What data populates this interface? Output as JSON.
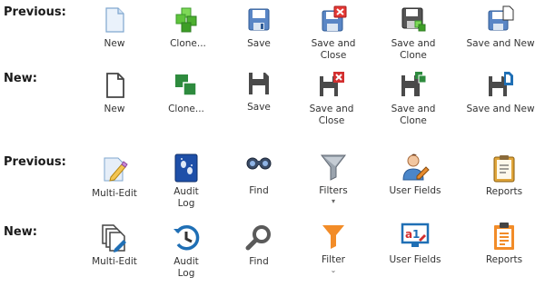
{
  "sections": {
    "s1_previous": "Previous:",
    "s1_new": "New:",
    "s2_previous": "Previous:",
    "s2_new": "New:"
  },
  "row1_previous": [
    {
      "icon": "new-doc-icon",
      "label": "New"
    },
    {
      "icon": "clone-icon",
      "label": "Clone..."
    },
    {
      "icon": "save-icon",
      "label": "Save"
    },
    {
      "icon": "save-and-close-icon",
      "label": "Save and\nClose"
    },
    {
      "icon": "save-and-clone-icon",
      "label": "Save and\nClone"
    },
    {
      "icon": "save-and-new-icon",
      "label": "Save and New"
    }
  ],
  "row1_new": [
    {
      "icon": "new-doc-icon",
      "label": "New"
    },
    {
      "icon": "clone-icon",
      "label": "Clone..."
    },
    {
      "icon": "save-icon",
      "label": "Save"
    },
    {
      "icon": "save-and-close-icon",
      "label": "Save and\nClose"
    },
    {
      "icon": "save-and-clone-icon",
      "label": "Save and\nClone"
    },
    {
      "icon": "save-and-new-icon",
      "label": "Save and New"
    }
  ],
  "row2_previous": [
    {
      "icon": "multi-edit-icon",
      "label": "Multi-Edit"
    },
    {
      "icon": "audit-log-icon",
      "label": "Audit\nLog"
    },
    {
      "icon": "find-binoculars-icon",
      "label": "Find"
    },
    {
      "icon": "filter-funnel-icon",
      "label": "Filters",
      "dropdown": "▾"
    },
    {
      "icon": "user-fields-icon",
      "label": "User Fields"
    },
    {
      "icon": "reports-clipboard-icon",
      "label": "Reports"
    }
  ],
  "row2_new": [
    {
      "icon": "multi-edit-icon",
      "label": "Multi-Edit"
    },
    {
      "icon": "audit-log-icon",
      "label": "Audit\nLog"
    },
    {
      "icon": "find-magnifier-icon",
      "label": "Find"
    },
    {
      "icon": "filter-funnel-icon",
      "label": "Filter",
      "dropdown": "⌄"
    },
    {
      "icon": "user-fields-icon",
      "label": "User Fields"
    },
    {
      "icon": "reports-clipboard-icon",
      "label": "Reports"
    }
  ],
  "colors": {
    "green": "#2e8b3e",
    "red": "#d32f2f",
    "blue": "#1f6fb5",
    "orange": "#f28c28",
    "dark": "#4a4a4a"
  }
}
